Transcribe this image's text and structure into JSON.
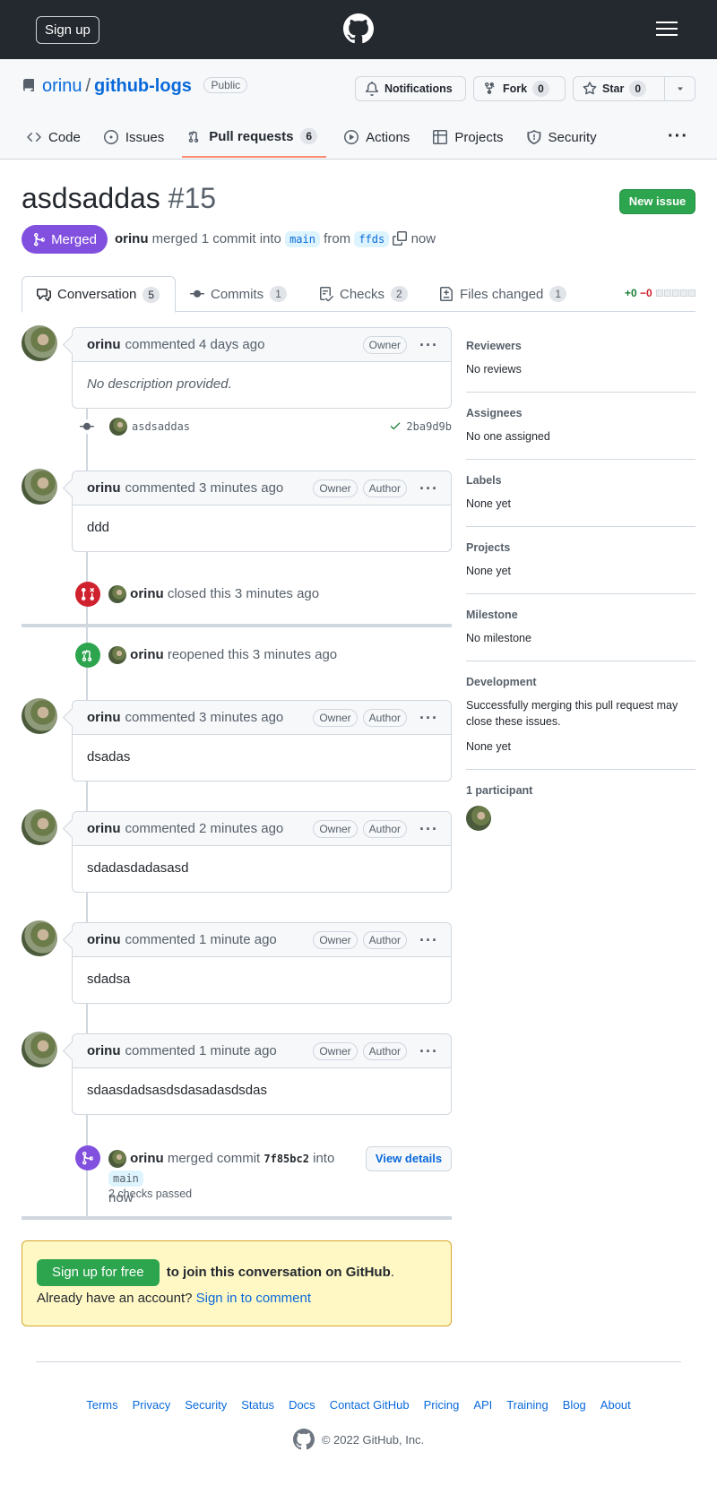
{
  "header": {
    "signup": "Sign up"
  },
  "repo": {
    "owner": "orinu",
    "slash": "/",
    "name": "github-logs",
    "visibility": "Public",
    "notifications": "Notifications",
    "fork": "Fork",
    "fork_count": "0",
    "star": "Star",
    "star_count": "0"
  },
  "nav": {
    "code": "Code",
    "issues": "Issues",
    "pulls": "Pull requests",
    "pulls_count": "6",
    "actions": "Actions",
    "projects": "Projects",
    "security": "Security",
    "more": "···"
  },
  "pr": {
    "title": "asdsaddas",
    "number": "#15",
    "new_issue": "New issue",
    "state": "Merged",
    "author": "orinu",
    "meta_mid": "merged 1 commit into",
    "base": "main",
    "from": "from",
    "head": "ffds",
    "time": "now"
  },
  "prtabs": {
    "conversation": "Conversation",
    "conversation_count": "5",
    "commits": "Commits",
    "commits_count": "1",
    "checks": "Checks",
    "checks_count": "2",
    "files": "Files changed",
    "files_count": "1",
    "add": "+0",
    "del": "−0"
  },
  "comments": [
    {
      "author": "orinu",
      "when": "commented 4 days ago",
      "labels": [
        "Owner"
      ],
      "body": "No description provided."
    },
    {
      "author": "orinu",
      "when": "commented 3 minutes ago",
      "labels": [
        "Owner",
        "Author"
      ],
      "body": "ddd"
    },
    {
      "author": "orinu",
      "when": "commented 3 minutes ago",
      "labels": [
        "Owner",
        "Author"
      ],
      "body": "dsadas"
    },
    {
      "author": "orinu",
      "when": "commented 2 minutes ago",
      "labels": [
        "Owner",
        "Author"
      ],
      "body": "sdadasdadasasd"
    },
    {
      "author": "orinu",
      "when": "commented 1 minute ago",
      "labels": [
        "Owner",
        "Author"
      ],
      "body": "sdadsa"
    },
    {
      "author": "orinu",
      "when": "commented 1 minute ago",
      "labels": [
        "Owner",
        "Author"
      ],
      "body": "sdaasdadsasdsdasadasdsdas"
    }
  ],
  "commit": {
    "message": "asdsaddas",
    "sha": "2ba9d9b"
  },
  "events": {
    "closed_user": "orinu",
    "closed_text": "closed this 3 minutes ago",
    "reopened_user": "orinu",
    "reopened_text": "reopened this 3 minutes ago",
    "merged_user": "orinu",
    "merged_text": "merged commit",
    "merged_sha": "7f85bc2",
    "merged_into": "into",
    "merged_base": "main",
    "merged_time": "now",
    "checks": "2 checks passed",
    "view_details": "View details"
  },
  "sidebar": {
    "reviewers_h": "Reviewers",
    "reviewers": "No reviews",
    "assignees_h": "Assignees",
    "assignees": "No one assigned",
    "labels_h": "Labels",
    "labels": "None yet",
    "projects_h": "Projects",
    "projects": "None yet",
    "milestone_h": "Milestone",
    "milestone": "No milestone",
    "dev_h": "Development",
    "dev_text": "Successfully merging this pull request may close these issues.",
    "dev_none": "None yet",
    "participants_h": "1 participant"
  },
  "join": {
    "button": "Sign up for free",
    "text1": "to join this conversation on GitHub",
    "text2": ". Already have an account?",
    "signin": "Sign in to comment"
  },
  "footer": {
    "links": [
      "Terms",
      "Privacy",
      "Security",
      "Status",
      "Docs",
      "Contact GitHub",
      "Pricing",
      "API",
      "Training",
      "Blog",
      "About"
    ],
    "copyright": "© 2022 GitHub, Inc."
  },
  "colors": {
    "merged": "#8250df",
    "green": "#2da44e",
    "closed": "#cf222e",
    "header": "#24292f"
  }
}
